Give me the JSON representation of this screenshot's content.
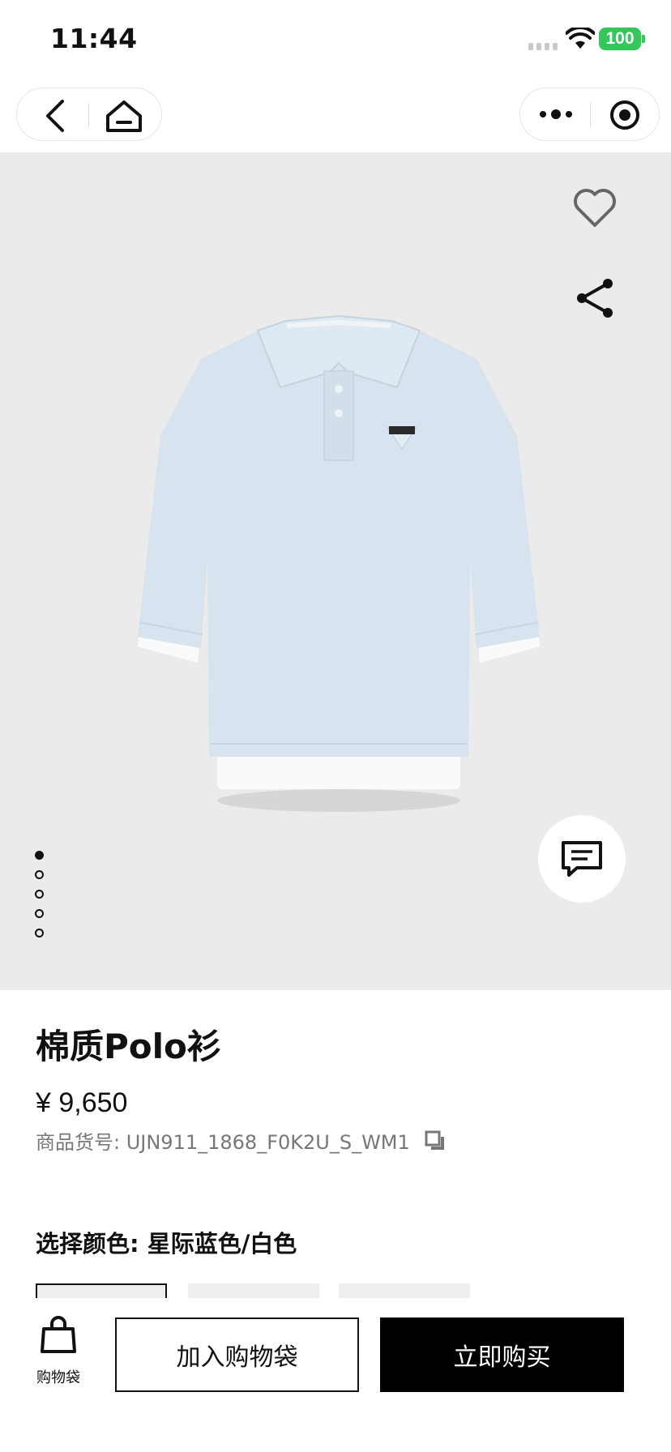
{
  "status_bar": {
    "time": "11:44",
    "battery": "100"
  },
  "nav": {
    "back_icon": "chevron-left-icon",
    "home_icon": "home-icon",
    "more_icon": "more-dots-icon",
    "target_icon": "target-icon"
  },
  "gallery": {
    "image_alt": "light-blue polo shirt",
    "favorite_icon": "heart-icon",
    "share_icon": "share-icon",
    "chat_icon": "chat-icon",
    "page_count": 5,
    "active_page": 1
  },
  "product": {
    "title": "棉质Polo衫",
    "price": "¥ 9,650",
    "sku": "商品货号: UJN911_1868_F0K2U_S_WM1",
    "copy_icon": "copy-icon",
    "color_label": "选择颜色: 星际蓝色/白色"
  },
  "bottom_bar": {
    "bag_label": "购物袋",
    "add_to_bag": "加入购物袋",
    "buy_now": "立即购买"
  },
  "colors": {
    "battery_green": "#34c759",
    "gallery_bg": "#ebebeb",
    "shirt_blue": "#d7e3ee",
    "buy_button": "#000000"
  }
}
